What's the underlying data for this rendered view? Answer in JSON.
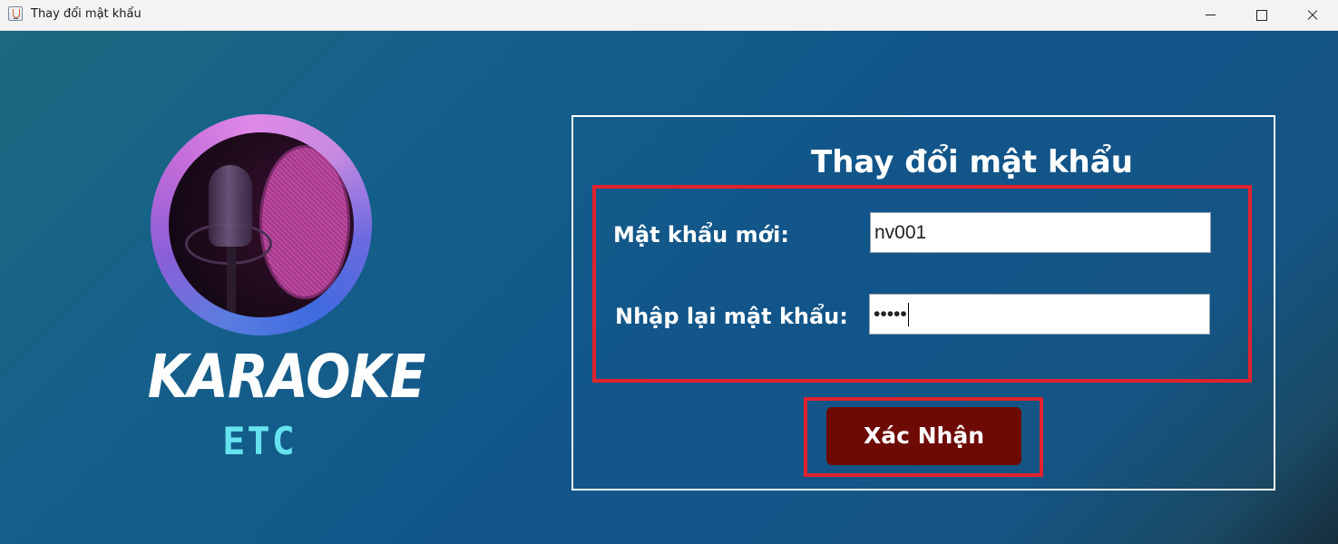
{
  "window": {
    "title": "Thay đổi mật khẩu",
    "icon": "java-cup-icon",
    "controls": [
      "minimize-icon",
      "maximize-icon",
      "close-icon"
    ]
  },
  "logo": {
    "word": "KARAOKE",
    "sub": "ETC",
    "sub_color": "#66e3ef"
  },
  "form": {
    "title": "Thay đổi mật khẩu",
    "new_password": {
      "label": "Mật khẩu mới:",
      "value": "nv001"
    },
    "confirm_password": {
      "label": "Nhập lại mật khẩu:",
      "value": "•••••"
    },
    "submit_label": "Xác Nhận"
  },
  "colors": {
    "highlight_border": "#e0222e",
    "submit_bg": "#6e0a04",
    "panel_border": "#ffffff"
  }
}
